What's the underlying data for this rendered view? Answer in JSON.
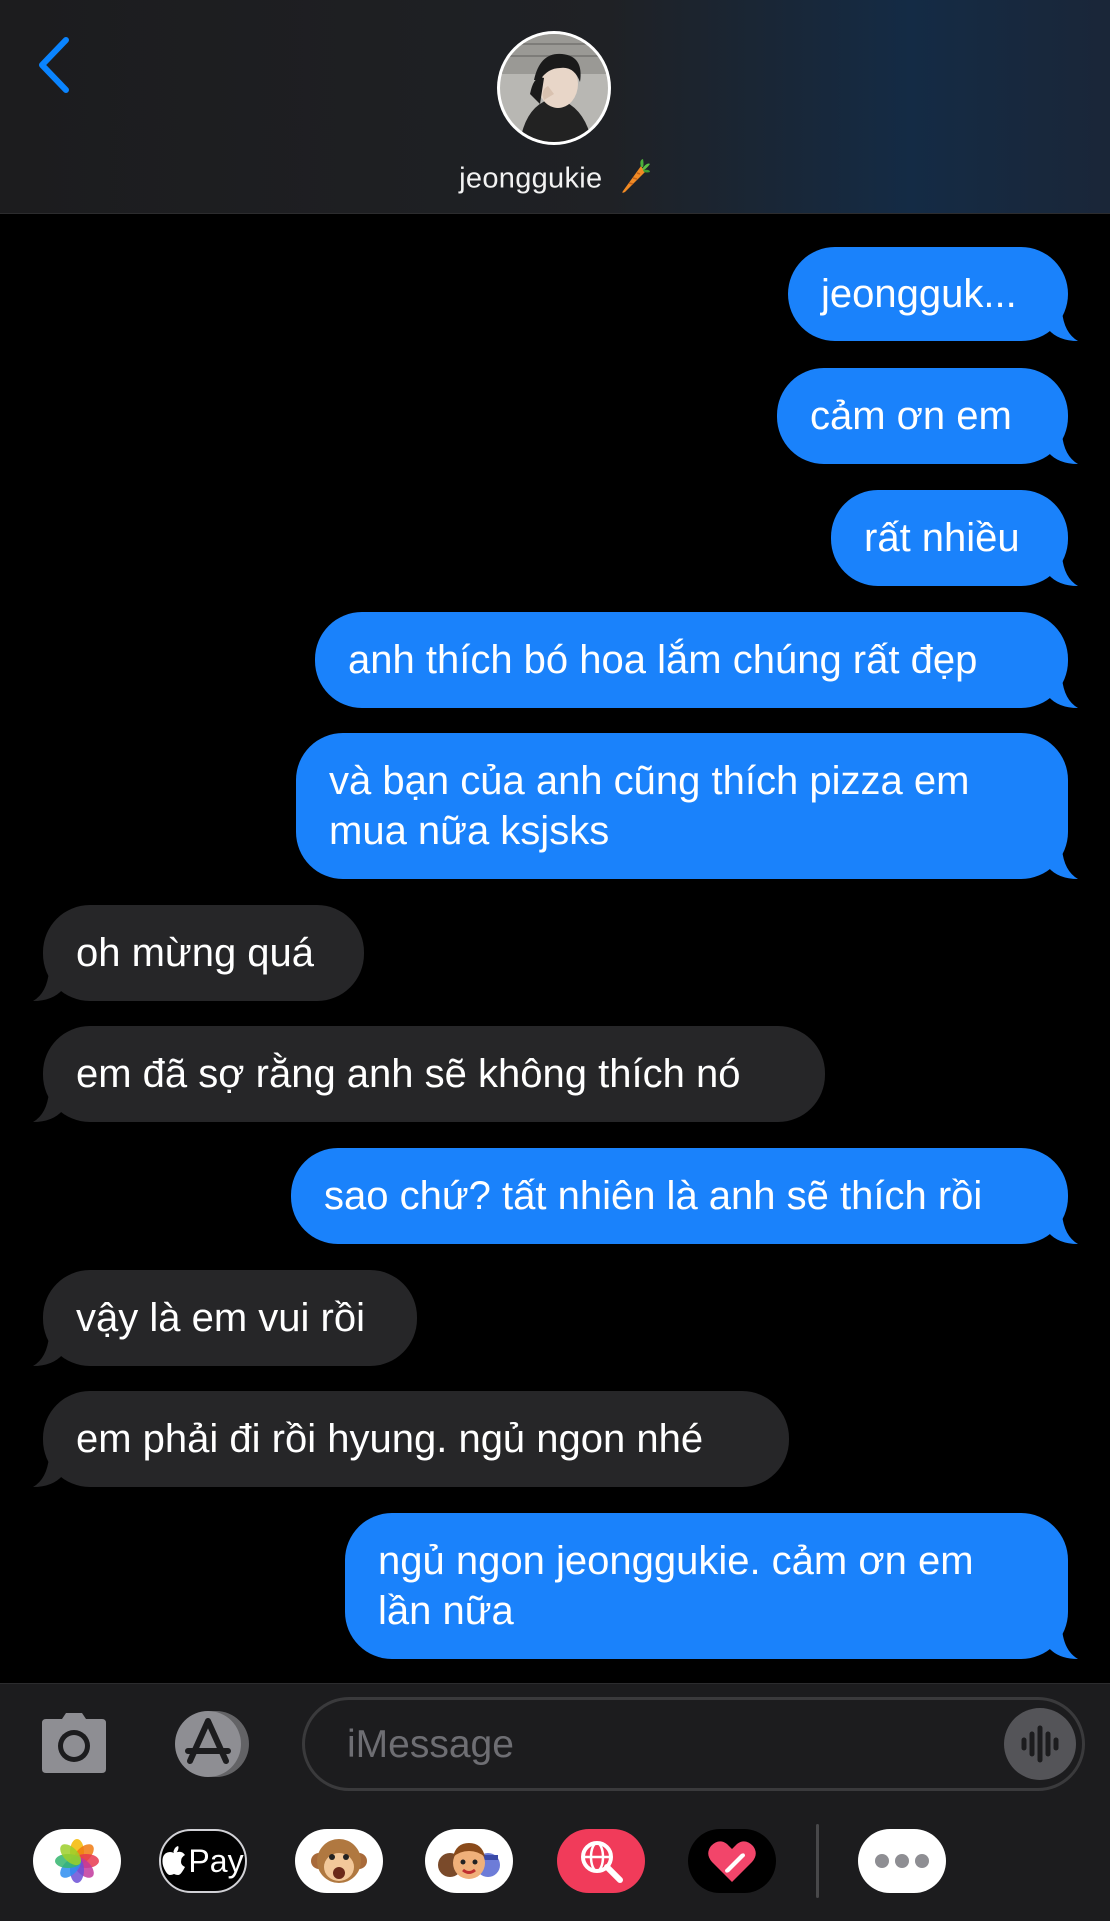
{
  "header": {
    "contact_name": "jeonggukie",
    "contact_emoji": "carrot",
    "back_icon": "chevron-left-icon"
  },
  "messages": [
    {
      "side": "sent",
      "text": "jeongguk..."
    },
    {
      "side": "sent",
      "text": "cảm ơn em"
    },
    {
      "side": "sent",
      "text": "rất nhiều"
    },
    {
      "side": "sent",
      "text": "anh thích bó hoa lắm chúng rất đẹp"
    },
    {
      "side": "sent",
      "text": "và bạn của anh cũng thích pizza em mua nữa ksjsks"
    },
    {
      "side": "received",
      "text": "oh mừng quá"
    },
    {
      "side": "received",
      "text": "em đã sợ rằng anh sẽ không thích nó"
    },
    {
      "side": "sent",
      "text": "sao chứ? tất nhiên là anh sẽ thích rồi"
    },
    {
      "side": "received",
      "text": "vậy là em vui rồi"
    },
    {
      "side": "received",
      "text": "em phải đi rồi hyung. ngủ ngon nhé"
    },
    {
      "side": "sent",
      "text": "ngủ ngon jeonggukie. cảm ơn em lần nữa"
    }
  ],
  "compose": {
    "placeholder": "iMessage",
    "camera_icon": "camera-icon",
    "appstore_icon": "app-store-icon",
    "audio_icon": "audio-waveform-icon"
  },
  "app_drawer": {
    "apple_pay_label": "Pay",
    "apps": [
      "photos-icon",
      "apple-pay-icon",
      "animoji-icon",
      "memoji-icon",
      "web-search-icon",
      "digital-touch-icon",
      "more-icon"
    ]
  },
  "colors": {
    "sent_bubble": "#1a82fb",
    "received_bubble": "#262628",
    "accent": "#0a84ff"
  }
}
